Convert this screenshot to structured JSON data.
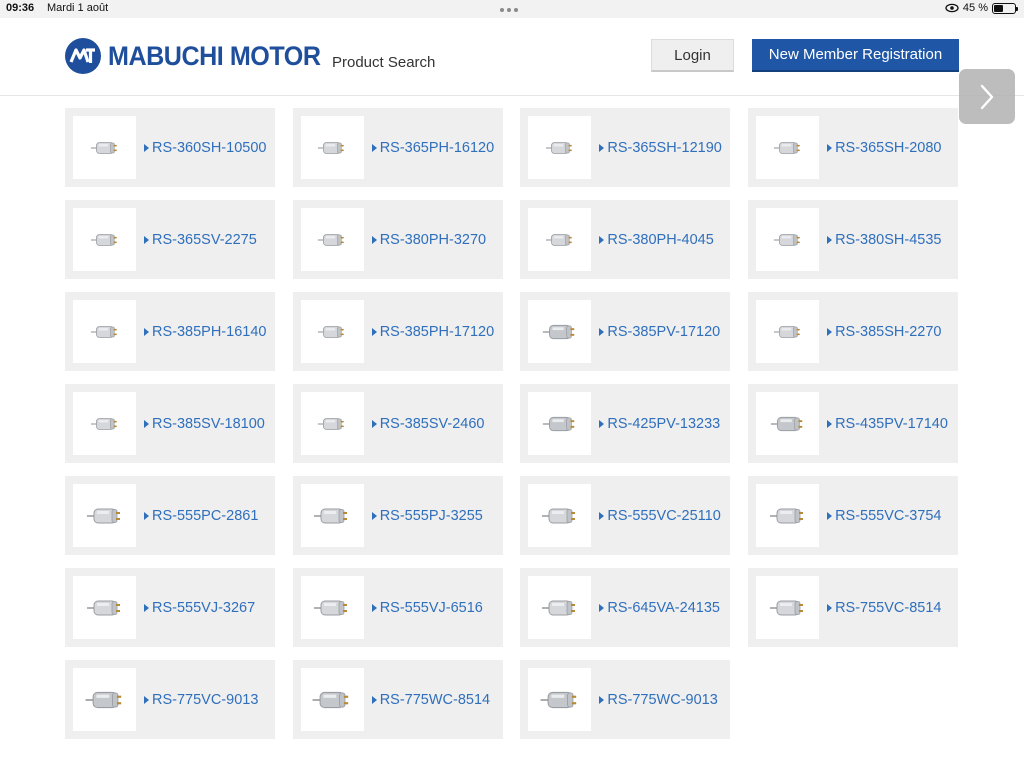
{
  "status_bar": {
    "time": "09:36",
    "date": "Mardi 1 août",
    "battery": "45 %",
    "battery_level": 0.45
  },
  "header": {
    "logo_text": "MABUCHI MOTOR",
    "title": "Product Search",
    "login_label": "Login",
    "register_label": "New Member Registration",
    "brand_color": "#1f4f9c",
    "button_color": "#1f57a6"
  },
  "navigation": {
    "next_icon": "chevron-right-icon"
  },
  "products": [
    {
      "name": "RS-360SH-10500",
      "icon": "motor-small-icon"
    },
    {
      "name": "RS-365PH-16120",
      "icon": "motor-small-icon"
    },
    {
      "name": "RS-365SH-12190",
      "icon": "motor-small-icon"
    },
    {
      "name": "RS-365SH-2080",
      "icon": "motor-small-icon"
    },
    {
      "name": "RS-365SV-2275",
      "icon": "motor-small-icon"
    },
    {
      "name": "RS-380PH-3270",
      "icon": "motor-small-icon"
    },
    {
      "name": "RS-380PH-4045",
      "icon": "motor-small-icon"
    },
    {
      "name": "RS-380SH-4535",
      "icon": "motor-small-icon"
    },
    {
      "name": "RS-385PH-16140",
      "icon": "motor-small-icon"
    },
    {
      "name": "RS-385PH-17120",
      "icon": "motor-small-icon"
    },
    {
      "name": "RS-385PV-17120",
      "icon": "motor-medium-icon"
    },
    {
      "name": "RS-385SH-2270",
      "icon": "motor-small-icon"
    },
    {
      "name": "RS-385SV-18100",
      "icon": "motor-small-icon"
    },
    {
      "name": "RS-385SV-2460",
      "icon": "motor-small-icon"
    },
    {
      "name": "RS-425PV-13233",
      "icon": "motor-medium-icon"
    },
    {
      "name": "RS-435PV-17140",
      "icon": "motor-medium-icon"
    },
    {
      "name": "RS-555PC-2861",
      "icon": "motor-large-icon"
    },
    {
      "name": "RS-555PJ-3255",
      "icon": "motor-large-icon"
    },
    {
      "name": "RS-555VC-25110",
      "icon": "motor-large-icon"
    },
    {
      "name": "RS-555VC-3754",
      "icon": "motor-large-icon"
    },
    {
      "name": "RS-555VJ-3267",
      "icon": "motor-large-icon"
    },
    {
      "name": "RS-555VJ-6516",
      "icon": "motor-large-icon"
    },
    {
      "name": "RS-645VA-24135",
      "icon": "motor-large-icon"
    },
    {
      "name": "RS-755VC-8514",
      "icon": "motor-large-icon"
    },
    {
      "name": "RS-775VC-9013",
      "icon": "motor-xl-icon"
    },
    {
      "name": "RS-775WC-8514",
      "icon": "motor-xl-icon"
    },
    {
      "name": "RS-775WC-9013",
      "icon": "motor-xl-icon"
    }
  ]
}
